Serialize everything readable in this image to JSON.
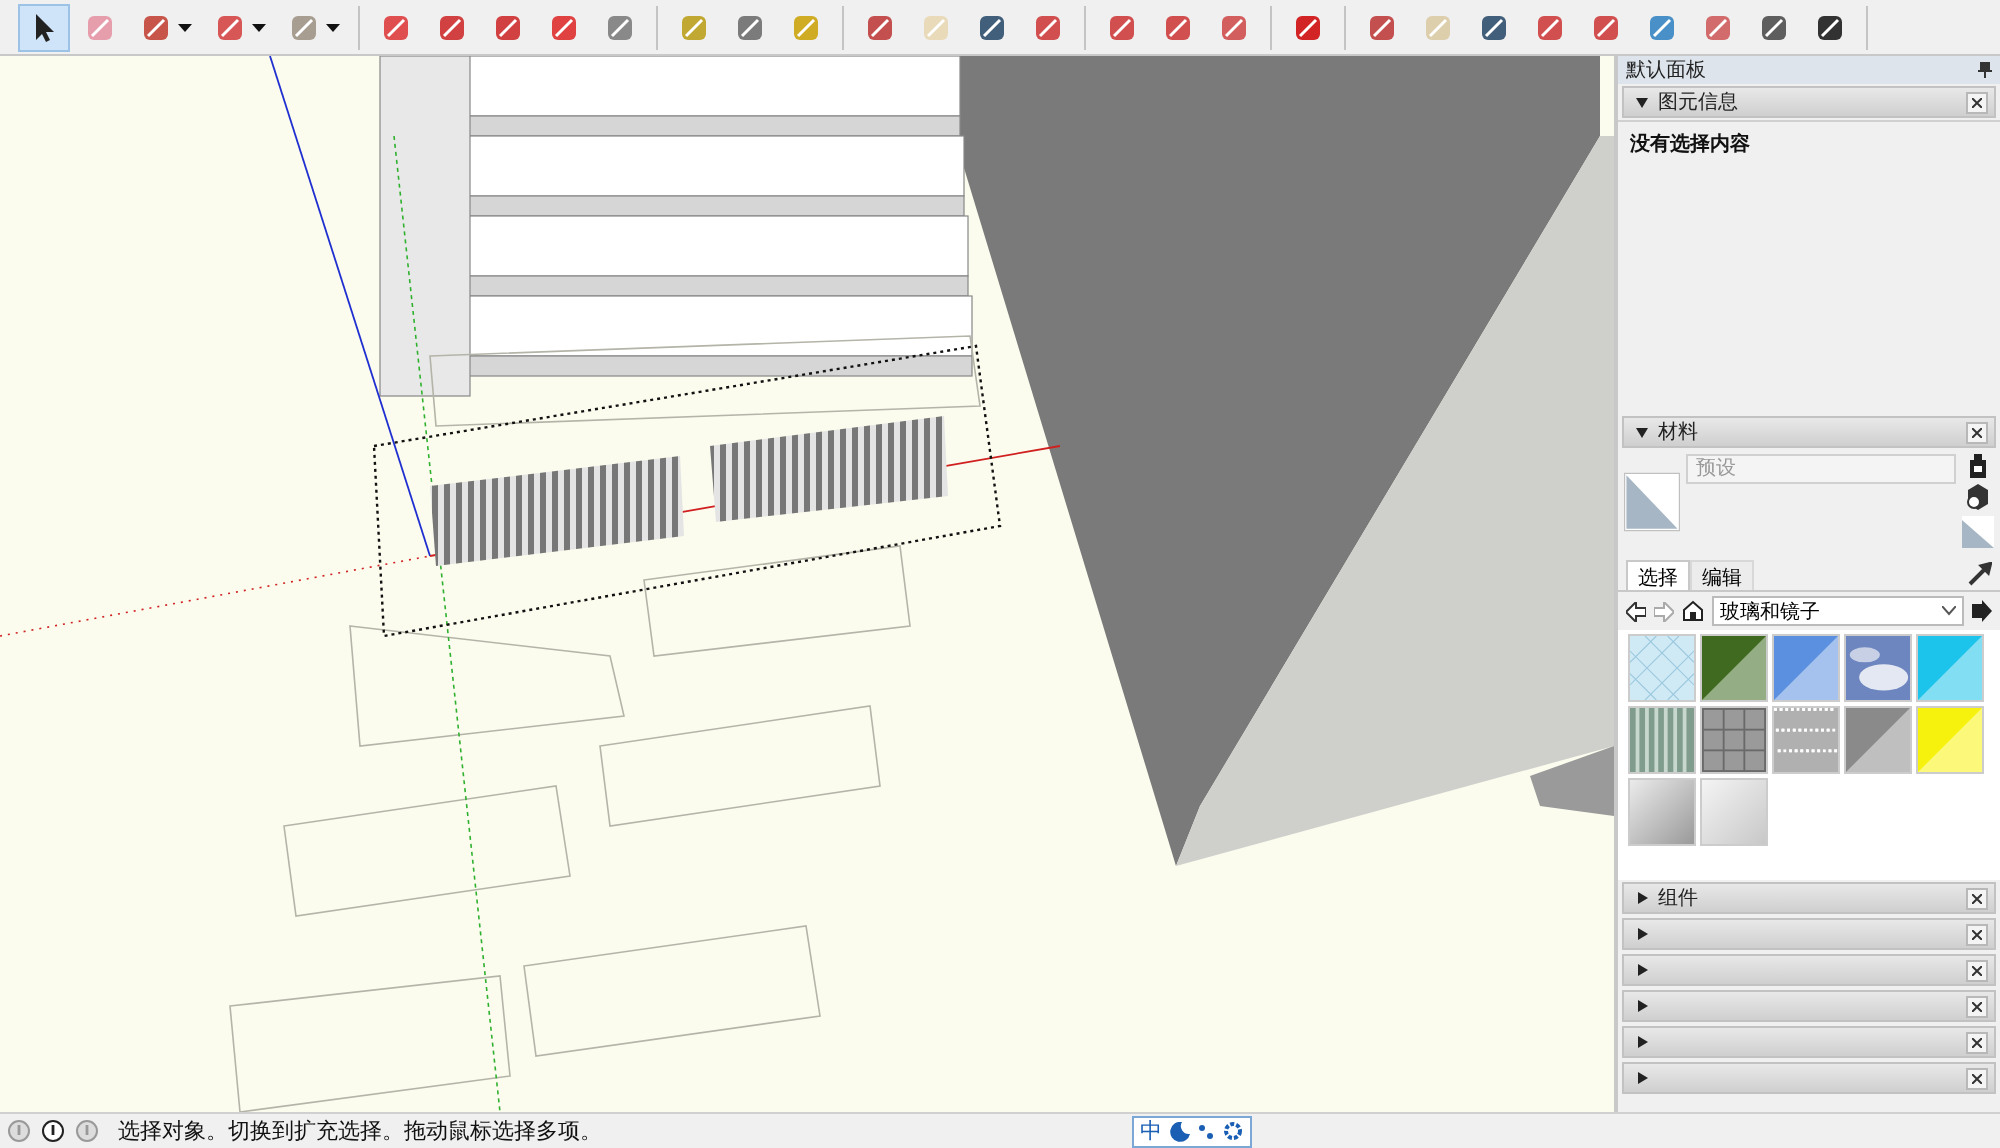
{
  "toolbar": {
    "groups": [
      {
        "tools": [
          {
            "selected": true,
            "dropdown": false
          },
          {
            "selected": false,
            "dropdown": false
          },
          {
            "selected": false,
            "dropdown": true
          },
          {
            "selected": false,
            "dropdown": true
          },
          {
            "selected": false,
            "dropdown": true
          }
        ]
      },
      {
        "tools": [
          {
            "selected": false,
            "dropdown": false
          },
          {
            "selected": false,
            "dropdown": false
          },
          {
            "selected": false,
            "dropdown": false
          },
          {
            "selected": false,
            "dropdown": false
          },
          {
            "selected": false,
            "dropdown": false
          }
        ]
      },
      {
        "tools": [
          {
            "selected": false,
            "dropdown": false
          },
          {
            "selected": false,
            "dropdown": false
          },
          {
            "selected": false,
            "dropdown": false
          }
        ]
      },
      {
        "tools": [
          {
            "selected": false,
            "dropdown": false
          },
          {
            "selected": false,
            "dropdown": false
          },
          {
            "selected": false,
            "dropdown": false
          },
          {
            "selected": false,
            "dropdown": false
          }
        ]
      },
      {
        "tools": [
          {
            "selected": false,
            "dropdown": false
          },
          {
            "selected": false,
            "dropdown": false
          },
          {
            "selected": false,
            "dropdown": false
          }
        ]
      },
      {
        "tools": [
          {
            "selected": false,
            "dropdown": false
          }
        ]
      },
      {
        "tools": [
          {
            "selected": false,
            "dropdown": false
          },
          {
            "selected": false,
            "dropdown": false
          },
          {
            "selected": false,
            "dropdown": false
          },
          {
            "selected": false,
            "dropdown": false
          },
          {
            "selected": false,
            "dropdown": false
          },
          {
            "selected": false,
            "dropdown": false
          },
          {
            "selected": false,
            "dropdown": false
          },
          {
            "selected": false,
            "dropdown": false
          },
          {
            "selected": false,
            "dropdown": false
          }
        ]
      }
    ]
  },
  "tray": {
    "title": "默认面板",
    "entity_info": {
      "title": "图元信息",
      "expanded": true,
      "message": "没有选择内容"
    },
    "materials": {
      "title": "材料",
      "expanded": true,
      "name_placeholder": "预设",
      "tabs": [
        {
          "label": "选择",
          "selected": true
        },
        {
          "label": "编辑",
          "selected": false
        }
      ],
      "library": "玻璃和镜子",
      "swatches": [
        {
          "kind": "grid",
          "color": "#cfeaf5"
        },
        {
          "kind": "split",
          "color": "#3f6a1f"
        },
        {
          "kind": "split",
          "color": "#5b8fe0"
        },
        {
          "kind": "cloud",
          "color": "#6d86c0"
        },
        {
          "kind": "split",
          "color": "#1cc3ea"
        },
        {
          "kind": "stripes",
          "color": "#7f9c8c"
        },
        {
          "kind": "tiles",
          "color": "#6a6a6a"
        },
        {
          "kind": "speckle",
          "color": "#b0b0b0"
        },
        {
          "kind": "split",
          "color": "#8a8a8a"
        },
        {
          "kind": "split",
          "color": "#f7f20d"
        },
        {
          "kind": "gradient",
          "color": "#9a9a9a"
        },
        {
          "kind": "gradient",
          "color": "#c8c8c8"
        }
      ]
    },
    "collapsed_panels": [
      {
        "title": "组件",
        "expanded": false
      },
      {
        "expanded": false
      },
      {
        "expanded": false
      },
      {
        "expanded": false
      },
      {
        "expanded": false
      },
      {
        "expanded": false
      }
    ]
  },
  "status_bar": {
    "message": "选择对象。切换到扩充选择。拖动鼠标选择多项。",
    "ime": "中"
  }
}
